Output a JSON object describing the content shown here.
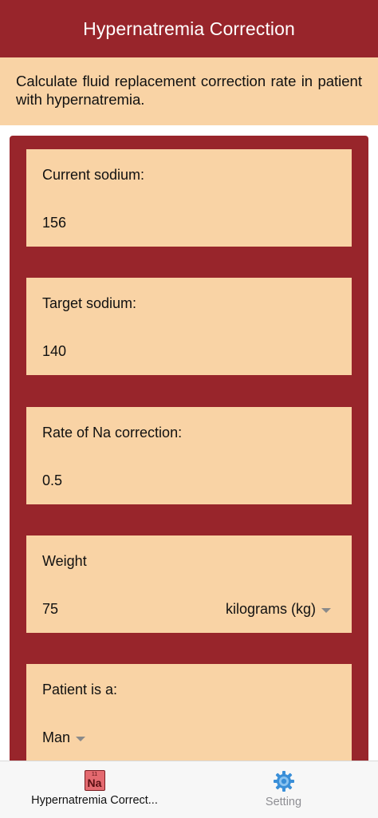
{
  "header": {
    "title": "Hypernatremia Correction"
  },
  "description": {
    "text": "Calculate fluid replacement correction rate in patient with hypernatremia."
  },
  "form": {
    "current_sodium": {
      "label": "Current sodium:",
      "value": "156"
    },
    "target_sodium": {
      "label": "Target sodium:",
      "value": "140"
    },
    "rate_correction": {
      "label": "Rate of Na correction:",
      "value": "0.5"
    },
    "weight": {
      "label": "Weight",
      "value": "75",
      "unit": "kilograms (kg)"
    },
    "patient": {
      "label": "Patient is a:",
      "value": "Man"
    }
  },
  "tabbar": {
    "tabs": [
      {
        "label": "Hypernatremia Correct...",
        "icon": "sodium-element-icon",
        "icon_number": "11",
        "icon_symbol": "Na",
        "active": true
      },
      {
        "label": "Setting",
        "icon": "gear-icon",
        "active": false
      }
    ]
  },
  "colors": {
    "brand": "#98252b",
    "card": "#f9d3a5",
    "gear": "#3a8fd8"
  }
}
